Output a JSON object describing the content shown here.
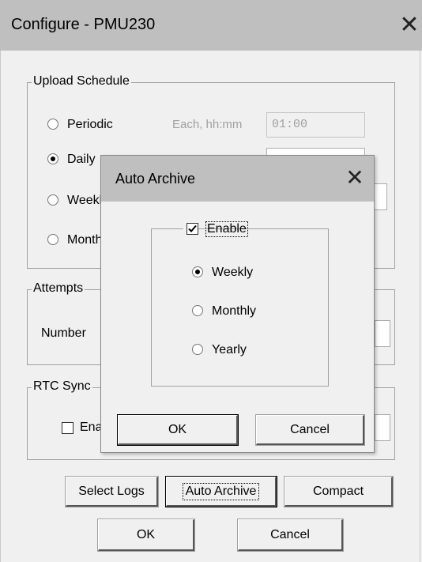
{
  "window": {
    "title": "Configure - PMU230",
    "close_glyph": "✕"
  },
  "upload_schedule": {
    "legend": "Upload Schedule",
    "options": [
      {
        "label": "Periodic",
        "selected": false
      },
      {
        "label": "Daily",
        "selected": true
      },
      {
        "label": "Weekly",
        "selected": false
      },
      {
        "label": "Monthly",
        "selected": false
      }
    ],
    "periodic_hint": "Each, hh:mm",
    "periodic_value": "01:00"
  },
  "attempts": {
    "legend": "Attempts",
    "number_label": "Number",
    "number_value": ""
  },
  "rtc_sync": {
    "legend": "RTC Sync",
    "enable_label": "Enable",
    "enabled": false
  },
  "buttons": {
    "select_logs": "Select Logs",
    "auto_archive": "Auto Archive",
    "compact": "Compact",
    "ok": "OK",
    "cancel": "Cancel"
  },
  "auto_archive_dialog": {
    "title": "Auto Archive",
    "close_glyph": "✕",
    "enable_label": "Enable",
    "enabled": true,
    "options": [
      {
        "label": "Weekly",
        "selected": true
      },
      {
        "label": "Monthly",
        "selected": false
      },
      {
        "label": "Yearly",
        "selected": false
      }
    ],
    "ok": "OK",
    "cancel": "Cancel"
  }
}
